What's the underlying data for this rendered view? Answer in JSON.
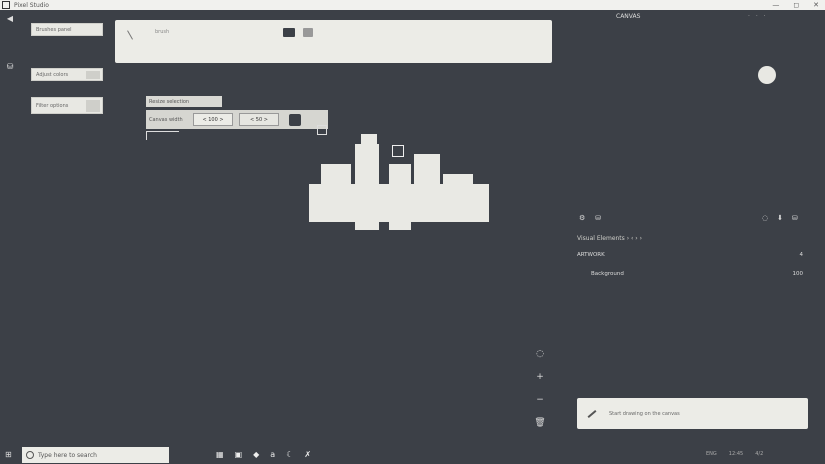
{
  "window": {
    "title": "Pixel Studio",
    "controls": [
      "—",
      "◻",
      "✕"
    ]
  },
  "left_panel": {
    "buttons": [
      "Brushes panel",
      "Adjust colors",
      "Filter options"
    ]
  },
  "toolbar": {
    "label": "brush"
  },
  "floating_window": {
    "title": "Resize selection",
    "label": "Canvas width",
    "fields": [
      "< 100 >",
      "< 50 >"
    ]
  },
  "right_panel": {
    "title": "CANVAS",
    "dots": "· · ·",
    "section_header": "Visual Elements  ›  ‹ ›  ›",
    "layers": [
      {
        "name": "ARTWORK",
        "value": "4"
      },
      {
        "name": "Background",
        "value": "100"
      }
    ]
  },
  "notice": {
    "text": "Start drawing on the canvas"
  },
  "taskbar": {
    "search_placeholder": "Type here to search",
    "tray": [
      "ENG",
      "12:45",
      "4/2"
    ]
  },
  "icons": {
    "collapse": "◀",
    "layers": "⛁",
    "settings": "⚙",
    "export": "⬇",
    "target": "◌",
    "plus": "+",
    "minus": "−",
    "trash": "🗑",
    "start": "⊞"
  }
}
